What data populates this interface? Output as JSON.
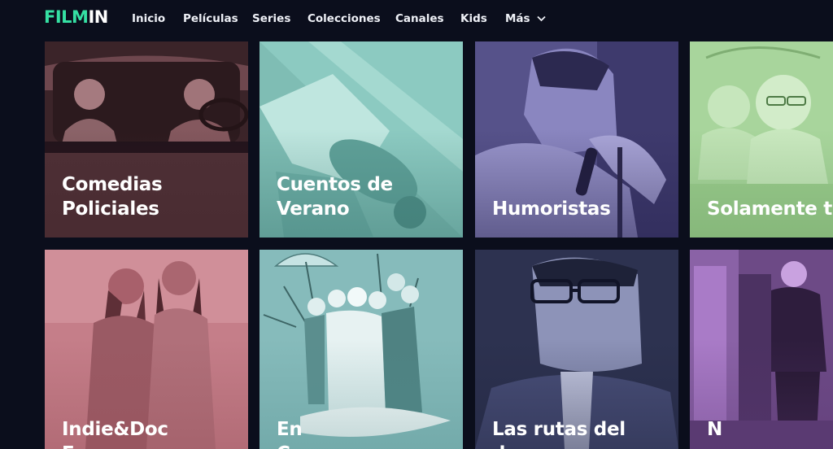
{
  "brand": {
    "logo_main": "FILM",
    "logo_accent": "IN",
    "logo_color": "#35e0a3"
  },
  "nav": {
    "items": [
      {
        "label": "Inicio"
      },
      {
        "label": "Películas"
      },
      {
        "label": "Series"
      },
      {
        "label": "Colecciones"
      },
      {
        "label": "Canales"
      },
      {
        "label": "Kids"
      },
      {
        "label": "Más"
      }
    ],
    "more_icon": "chevron-down-icon"
  },
  "collections": {
    "row1": [
      {
        "title": "Comedias\nPoliciales",
        "tint": "#7b4f55"
      },
      {
        "title": "Cuentos de\nVerano",
        "tint": "#7ab9b1"
      },
      {
        "title": "Humoristas",
        "tint": "#7d78b5"
      },
      {
        "title": "Solamente t",
        "tint": "#a6d39b"
      }
    ],
    "row2": [
      {
        "title": "Indie&Doc\nF",
        "tint": "#c77d88"
      },
      {
        "title": "En\nC",
        "tint": "#8fc0c0"
      },
      {
        "title": "Las rutas del\nd",
        "tint": "#636b93"
      },
      {
        "title": "N",
        "tint": "#a26ab8"
      }
    ]
  },
  "colors": {
    "background": "#0b0e1c",
    "nav_text": "#eef0f6"
  }
}
